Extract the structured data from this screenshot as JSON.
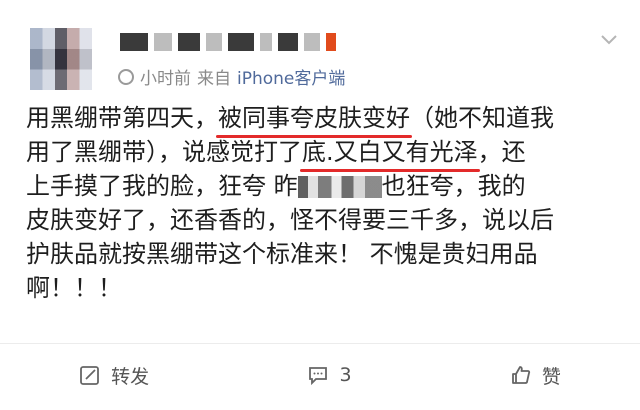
{
  "post": {
    "time": "小时前",
    "source_prefix": "来自",
    "source_app": "iPhone客户端",
    "body_lines": [
      [
        "用黑绷带第四天，",
        "被同事夸皮肤变好",
        "（她不知道我"
      ],
      [
        "用了黑绷带），说感觉打了",
        "底.",
        "又白又有光泽",
        "，还"
      ],
      [
        "上手摸了我的脸，狂夸 昨",
        "也狂夸，我的"
      ],
      [
        "皮肤变好了，还香香的，怪不得要三千多，说以后"
      ],
      [
        "护肤品就按黑绷带这个标准来！ 不愧是贵妇用品"
      ],
      [
        "啊！！！"
      ]
    ]
  },
  "actions": {
    "repost_label": "转发",
    "comment_count": "3",
    "like_label": "赞"
  }
}
